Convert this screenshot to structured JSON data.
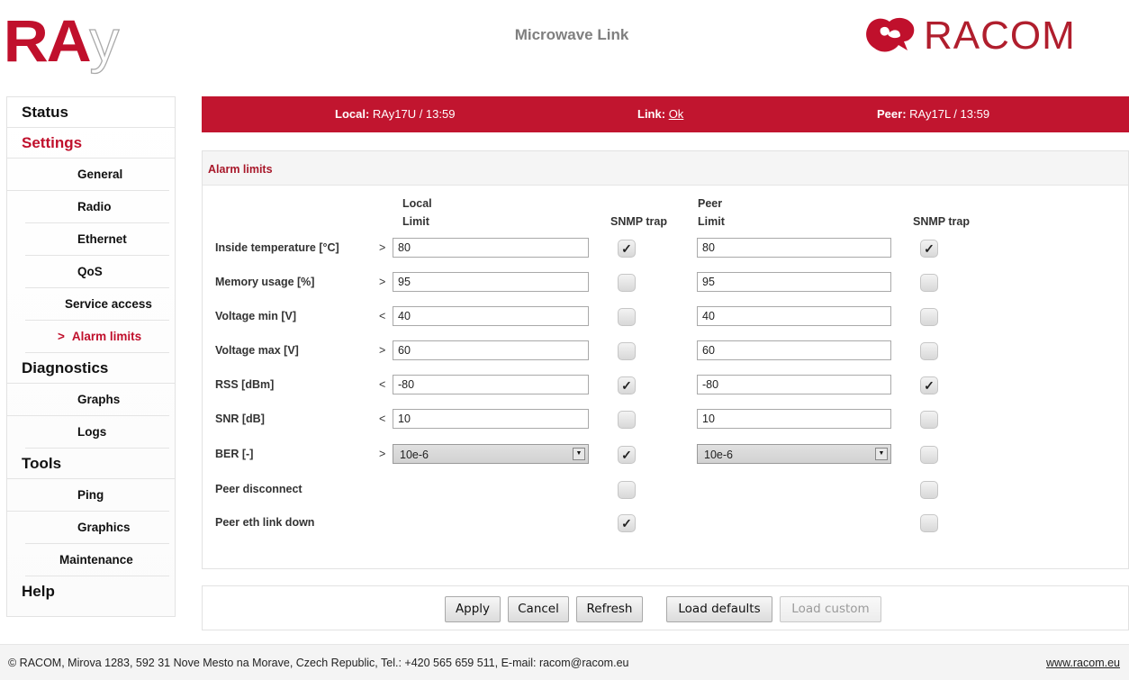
{
  "header": {
    "logo_left": {
      "ra": "RA",
      "y": "y"
    },
    "title": "Microwave Link",
    "logo_right": {
      "word": "RACOM",
      "icon": "racom-bird-icon"
    }
  },
  "sidebar": {
    "status": "Status",
    "settings": "Settings",
    "settings_items": [
      "General",
      "Radio",
      "Ethernet",
      "QoS",
      "Service access",
      "Alarm limits"
    ],
    "active_arrow": ">",
    "diagnostics": "Diagnostics",
    "diagnostics_items": [
      "Graphs",
      "Logs"
    ],
    "tools": "Tools",
    "tools_items": [
      "Ping",
      "Graphics",
      "Maintenance"
    ],
    "help": "Help"
  },
  "statusbar": {
    "local_label": "Local:",
    "local_value": "RAy17U / 13:59",
    "link_label": "Link:",
    "link_value": "Ok",
    "peer_label": "Peer:",
    "peer_value": "RAy17L / 13:59"
  },
  "panel": {
    "title": "Alarm limits",
    "headers": {
      "local_top": "Local",
      "local_limit": "Limit",
      "local_trap": "SNMP trap",
      "peer_top": "Peer",
      "peer_limit": "Limit",
      "peer_trap": "SNMP trap"
    },
    "rows": [
      {
        "label": "Inside temperature [°C]",
        "op": ">",
        "local": "80",
        "local_trap": true,
        "peer": "80",
        "peer_trap": true
      },
      {
        "label": "Memory usage [%]",
        "op": ">",
        "local": "95",
        "local_trap": false,
        "peer": "95",
        "peer_trap": false
      },
      {
        "label": "Voltage min [V]",
        "op": "<",
        "local": "40",
        "local_trap": false,
        "peer": "40",
        "peer_trap": false
      },
      {
        "label": "Voltage max [V]",
        "op": ">",
        "local": "60",
        "local_trap": false,
        "peer": "60",
        "peer_trap": false
      },
      {
        "label": "RSS [dBm]",
        "op": "<",
        "local": "-80",
        "local_trap": true,
        "peer": "-80",
        "peer_trap": true
      },
      {
        "label": "SNR [dB]",
        "op": "<",
        "local": "10",
        "local_trap": false,
        "peer": "10",
        "peer_trap": false
      },
      {
        "label": "BER [-]",
        "op": ">",
        "local": "10e-6",
        "local_trap": true,
        "peer": "10e-6",
        "peer_trap": false
      },
      {
        "label": "Peer disconnect",
        "local_trap": false,
        "peer_trap": false
      },
      {
        "label": "Peer eth link down",
        "local_trap": true,
        "peer_trap": false
      }
    ],
    "check_glyph": "✓",
    "dropdown_glyph": "▼"
  },
  "buttons": {
    "apply": "Apply",
    "cancel": "Cancel",
    "refresh": "Refresh",
    "load_defaults": "Load defaults",
    "load_custom": "Load custom"
  },
  "footer": {
    "copyright": "© RACOM, Mirova 1283, 592 31 Nove Mesto na Morave, Czech Republic, Tel.: +420 565 659 511, E-mail: racom@racom.eu",
    "website": "www.racom.eu"
  }
}
